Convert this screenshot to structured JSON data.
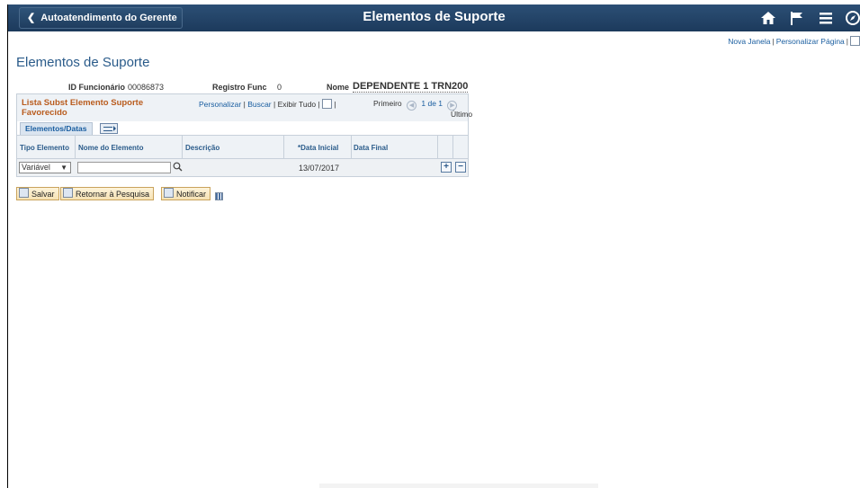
{
  "header": {
    "back_label": "Autoatendimento do Gerente",
    "title": "Elementos de Suporte",
    "icons": [
      "home-icon",
      "flag-icon",
      "menu-icon",
      "navbar-icon"
    ]
  },
  "links": {
    "new_window": "Nova Janela",
    "personalize_page": "Personalizar Página",
    "separator": "|"
  },
  "page": {
    "title": "Elementos de Suporte",
    "employee_id_label": "ID Funcionário",
    "employee_id": "00086873",
    "record_label": "Registro Func",
    "record": "0",
    "name_label": "Nome",
    "name": "DEPENDENTE 1 TRN200"
  },
  "grid": {
    "title": "Lista Subst Elemento Suporte Favorecido",
    "personalize": "Personalizar",
    "find": "Buscar",
    "view_all": "Exibir Tudo",
    "first": "Primeiro",
    "page_info": "1 de 1",
    "last": "Último",
    "tab_label": "Elementos/Datas",
    "columns": [
      "Tipo Elemento",
      "Nome do Elemento",
      "Descrição",
      "*Data Inicial",
      "Data Final"
    ],
    "rows": [
      {
        "type": "Variável",
        "name": "",
        "description": "",
        "start_date": "13/07/2017",
        "end_date": ""
      }
    ]
  },
  "actions": {
    "save": "Salvar",
    "return_search": "Retornar à Pesquisa",
    "notify": "Notificar"
  }
}
